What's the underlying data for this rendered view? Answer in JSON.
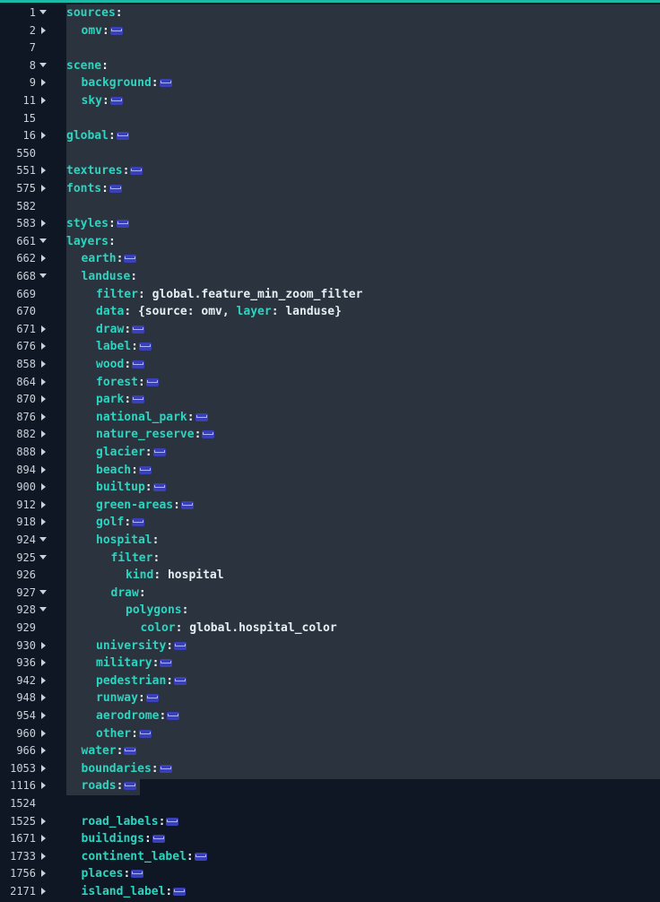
{
  "colors": {
    "background": "#0f1724",
    "selection": "#2a333e",
    "key": "#2dd4bf",
    "accent_bar": "#1bb9a6",
    "fold_marker": "#3b3fb8"
  },
  "lines": [
    {
      "n": "1",
      "fold": "open",
      "indent": 0,
      "key": "sources",
      "colon": ":",
      "rest": "",
      "marker": false
    },
    {
      "n": "2",
      "fold": "closed",
      "indent": 1,
      "key": "omv",
      "colon": ":",
      "rest": "",
      "marker": true
    },
    {
      "n": "7",
      "fold": "",
      "indent": 0,
      "key": "",
      "colon": "",
      "rest": "",
      "marker": false
    },
    {
      "n": "8",
      "fold": "open",
      "indent": 0,
      "key": "scene",
      "colon": ":",
      "rest": "",
      "marker": false
    },
    {
      "n": "9",
      "fold": "closed",
      "indent": 1,
      "key": "background",
      "colon": ":",
      "rest": "",
      "marker": true
    },
    {
      "n": "11",
      "fold": "closed",
      "indent": 1,
      "key": "sky",
      "colon": ":",
      "rest": "",
      "marker": true
    },
    {
      "n": "15",
      "fold": "",
      "indent": 0,
      "key": "",
      "colon": "",
      "rest": "",
      "marker": false
    },
    {
      "n": "16",
      "fold": "closed",
      "indent": 0,
      "key": "global",
      "colon": ":",
      "rest": "",
      "marker": true
    },
    {
      "n": "550",
      "fold": "",
      "indent": 0,
      "key": "",
      "colon": "",
      "rest": "",
      "marker": false
    },
    {
      "n": "551",
      "fold": "closed",
      "indent": 0,
      "key": "textures",
      "colon": ":",
      "rest": "",
      "marker": true
    },
    {
      "n": "575",
      "fold": "closed",
      "indent": 0,
      "key": "fonts",
      "colon": ":",
      "rest": "",
      "marker": true
    },
    {
      "n": "582",
      "fold": "",
      "indent": 0,
      "key": "",
      "colon": "",
      "rest": "",
      "marker": false
    },
    {
      "n": "583",
      "fold": "closed",
      "indent": 0,
      "key": "styles",
      "colon": ":",
      "rest": "",
      "marker": true
    },
    {
      "n": "661",
      "fold": "open",
      "indent": 0,
      "key": "layers",
      "colon": ":",
      "rest": "",
      "marker": false
    },
    {
      "n": "662",
      "fold": "closed",
      "indent": 1,
      "key": "earth",
      "colon": ":",
      "rest": "",
      "marker": true
    },
    {
      "n": "668",
      "fold": "open",
      "indent": 1,
      "key": "landuse",
      "colon": ":",
      "rest": "",
      "marker": false
    },
    {
      "n": "669",
      "fold": "",
      "indent": 2,
      "key": "filter",
      "colon": ":",
      "rest": " global.feature_min_zoom_filter",
      "marker": false
    },
    {
      "n": "670",
      "fold": "",
      "indent": 2,
      "key": "data",
      "colon": ":",
      "rest": " {source: omv, ",
      "kw": "layer",
      "rest2": ": landuse}",
      "marker": false
    },
    {
      "n": "671",
      "fold": "closed",
      "indent": 2,
      "key": "draw",
      "colon": ":",
      "rest": "",
      "marker": true
    },
    {
      "n": "676",
      "fold": "closed",
      "indent": 2,
      "key": "label",
      "colon": ":",
      "rest": "",
      "marker": true
    },
    {
      "n": "858",
      "fold": "closed",
      "indent": 2,
      "key": "wood",
      "colon": ":",
      "rest": "",
      "marker": true
    },
    {
      "n": "864",
      "fold": "closed",
      "indent": 2,
      "key": "forest",
      "colon": ":",
      "rest": "",
      "marker": true
    },
    {
      "n": "870",
      "fold": "closed",
      "indent": 2,
      "key": "park",
      "colon": ":",
      "rest": "",
      "marker": true
    },
    {
      "n": "876",
      "fold": "closed",
      "indent": 2,
      "key": "national_park",
      "colon": ":",
      "rest": "",
      "marker": true
    },
    {
      "n": "882",
      "fold": "closed",
      "indent": 2,
      "key": "nature_reserve",
      "colon": ":",
      "rest": "",
      "marker": true
    },
    {
      "n": "888",
      "fold": "closed",
      "indent": 2,
      "key": "glacier",
      "colon": ":",
      "rest": "",
      "marker": true
    },
    {
      "n": "894",
      "fold": "closed",
      "indent": 2,
      "key": "beach",
      "colon": ":",
      "rest": "",
      "marker": true
    },
    {
      "n": "900",
      "fold": "closed",
      "indent": 2,
      "key": "builtup",
      "colon": ":",
      "rest": "",
      "marker": true
    },
    {
      "n": "912",
      "fold": "closed",
      "indent": 2,
      "key": "green-areas",
      "colon": ":",
      "rest": "",
      "marker": true
    },
    {
      "n": "918",
      "fold": "closed",
      "indent": 2,
      "key": "golf",
      "colon": ":",
      "rest": "",
      "marker": true
    },
    {
      "n": "924",
      "fold": "open",
      "indent": 2,
      "key": "hospital",
      "colon": ":",
      "rest": "",
      "marker": false
    },
    {
      "n": "925",
      "fold": "open",
      "indent": 3,
      "key": "filter",
      "colon": ":",
      "rest": "",
      "marker": false
    },
    {
      "n": "926",
      "fold": "",
      "indent": 4,
      "key": "kind",
      "colon": ":",
      "rest": " hospital",
      "marker": false
    },
    {
      "n": "927",
      "fold": "open",
      "indent": 3,
      "key": "draw",
      "colon": ":",
      "rest": "",
      "marker": false
    },
    {
      "n": "928",
      "fold": "open",
      "indent": 4,
      "key": "polygons",
      "colon": ":",
      "rest": "",
      "marker": false
    },
    {
      "n": "929",
      "fold": "",
      "indent": 5,
      "key": "color",
      "colon": ":",
      "rest": " global.hospital_color",
      "marker": false
    },
    {
      "n": "930",
      "fold": "closed",
      "indent": 2,
      "key": "university",
      "colon": ":",
      "rest": "",
      "marker": true
    },
    {
      "n": "936",
      "fold": "closed",
      "indent": 2,
      "key": "military",
      "colon": ":",
      "rest": "",
      "marker": true
    },
    {
      "n": "942",
      "fold": "closed",
      "indent": 2,
      "key": "pedestrian",
      "colon": ":",
      "rest": "",
      "marker": true
    },
    {
      "n": "948",
      "fold": "closed",
      "indent": 2,
      "key": "runway",
      "colon": ":",
      "rest": "",
      "marker": true
    },
    {
      "n": "954",
      "fold": "closed",
      "indent": 2,
      "key": "aerodrome",
      "colon": ":",
      "rest": "",
      "marker": true
    },
    {
      "n": "960",
      "fold": "closed",
      "indent": 2,
      "key": "other",
      "colon": ":",
      "rest": "",
      "marker": true
    },
    {
      "n": "966",
      "fold": "closed",
      "indent": 1,
      "key": "water",
      "colon": ":",
      "rest": "",
      "marker": true
    },
    {
      "n": "1053",
      "fold": "closed",
      "indent": 1,
      "key": "boundaries",
      "colon": ":",
      "rest": "",
      "marker": true
    },
    {
      "n": "1116",
      "fold": "closed",
      "indent": 1,
      "key": "roads",
      "colon": ":",
      "rest": "",
      "marker": true
    },
    {
      "n": "1524",
      "fold": "",
      "indent": 0,
      "key": "",
      "colon": "",
      "rest": "",
      "marker": false
    },
    {
      "n": "1525",
      "fold": "closed",
      "indent": 1,
      "key": "road_labels",
      "colon": ":",
      "rest": "",
      "marker": true
    },
    {
      "n": "1671",
      "fold": "closed",
      "indent": 1,
      "key": "buildings",
      "colon": ":",
      "rest": "",
      "marker": true
    },
    {
      "n": "1733",
      "fold": "closed",
      "indent": 1,
      "key": "continent_label",
      "colon": ":",
      "rest": "",
      "marker": true
    },
    {
      "n": "1756",
      "fold": "closed",
      "indent": 1,
      "key": "places",
      "colon": ":",
      "rest": "",
      "marker": true
    },
    {
      "n": "2171",
      "fold": "closed",
      "indent": 1,
      "key": "island_label",
      "colon": ":",
      "rest": "",
      "marker": true
    }
  ]
}
